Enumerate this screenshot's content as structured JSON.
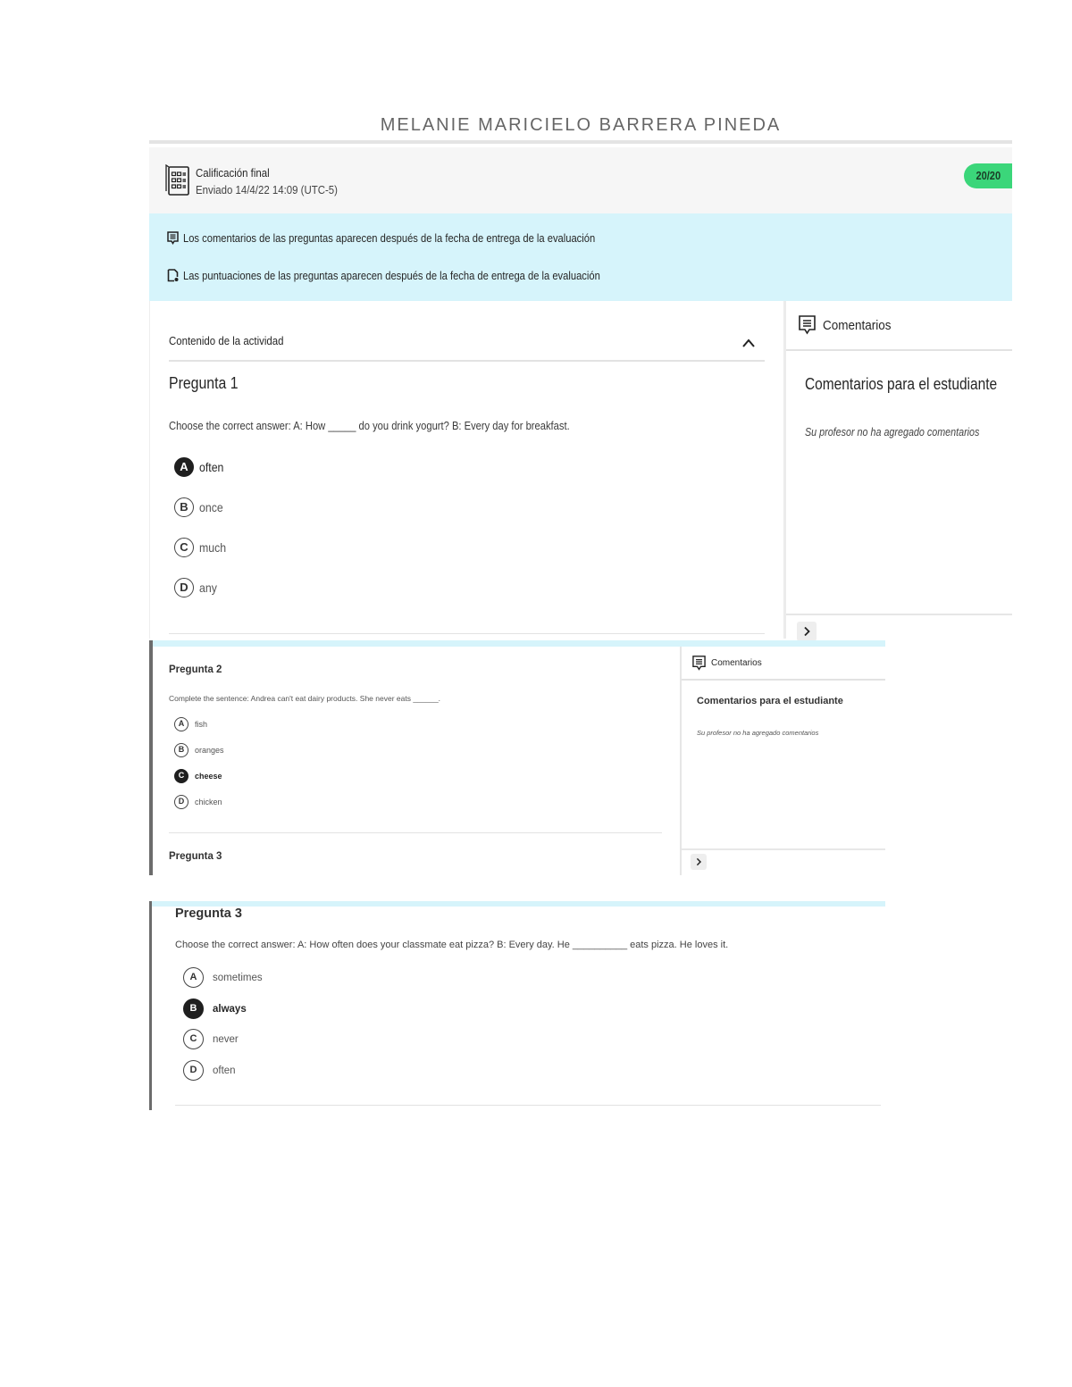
{
  "page_title": "MELANIE MARICIELO BARRERA PINEDA",
  "grade": {
    "title": "Calificación final",
    "submitted": "Enviado 14/4/22 14:09 (UTC-5)",
    "score": "20/20",
    "badge_color": "#3bd67a"
  },
  "notices": [
    {
      "icon": "comment-icon",
      "text": "Los comentarios de las preguntas aparecen después de la fecha de entrega de la evaluación"
    },
    {
      "icon": "score-icon",
      "text": "Las puntuaciones de las preguntas aparecen después de la fecha de entrega de la evaluación"
    }
  ],
  "activity": {
    "header": "Contenido de la actividad",
    "collapse_icon": "chevron-up-icon"
  },
  "comments_panel": {
    "title": "Comentarios",
    "subtitle": "Comentarios para el estudiante",
    "empty_text": "Su profesor no ha agregado comentarios",
    "next_icon": "chevron-right-icon"
  },
  "questions": [
    {
      "title": "Pregunta 1",
      "text": "Choose the correct answer: A: How _____ do you drink yogurt? B: Every day for breakfast.",
      "selected": "A",
      "options": [
        {
          "letter": "A",
          "label": "often"
        },
        {
          "letter": "B",
          "label": "once"
        },
        {
          "letter": "C",
          "label": "much"
        },
        {
          "letter": "D",
          "label": "any"
        }
      ]
    },
    {
      "title": "Pregunta 2",
      "text": "Complete the sentence: Andrea can't eat dairy products. She never eats ______.",
      "selected": "C",
      "options": [
        {
          "letter": "A",
          "label": "fish"
        },
        {
          "letter": "B",
          "label": "oranges"
        },
        {
          "letter": "C",
          "label": "cheese"
        },
        {
          "letter": "D",
          "label": "chicken"
        }
      ]
    },
    {
      "title": "Pregunta 3",
      "text": "Choose the correct answer: A: How often does your classmate eat pizza? B: Every day. He __________ eats pizza. He loves it.",
      "selected": "B",
      "options": [
        {
          "letter": "A",
          "label": "sometimes"
        },
        {
          "letter": "B",
          "label": "always"
        },
        {
          "letter": "C",
          "label": "never"
        },
        {
          "letter": "D",
          "label": "often"
        }
      ]
    }
  ],
  "colors": {
    "notice_bg": "#d6f4fb",
    "selected_bg": "#1f1f1f"
  }
}
